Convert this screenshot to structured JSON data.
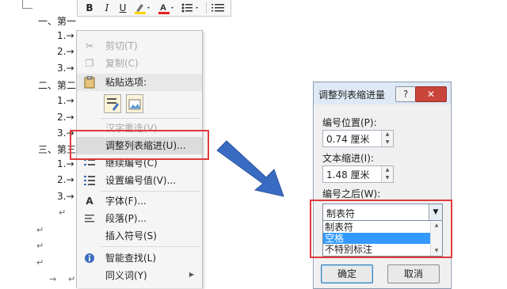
{
  "toolbar": {
    "bold": "B",
    "italic": "I",
    "underline": "U"
  },
  "document": {
    "lines": [
      "一、第一",
      "1.→",
      "2.→",
      "3.→",
      "二、第二",
      "1.→",
      "2.→",
      "3.→",
      "三、第三",
      "1.→",
      "2.→",
      "3.→"
    ],
    "tab_mark": "→",
    "para_mark": "↵"
  },
  "context_menu": {
    "cut": "剪切(T)",
    "copy": "复制(C)",
    "paste_options": "粘贴选项:",
    "reconvert": "汉字重选(V)",
    "adjust_indent": "调整列表缩进(U)...",
    "continue_numbering": "继续编号(C)",
    "set_number_value": "设置编号值(V)...",
    "font": "字体(F)...",
    "paragraph": "段落(P)...",
    "insert_symbol": "插入符号(S)",
    "smart_lookup": "智能查找(L)",
    "synonyms": "同义词(Y)"
  },
  "dialog": {
    "title": "调整列表缩进量",
    "help": "?",
    "close": "✕",
    "number_position_label": "编号位置(P):",
    "number_position_value": "0.74 厘米",
    "text_indent_label": "文本缩进(I):",
    "text_indent_value": "1.48 厘米",
    "follow_number_label": "编号之后(W):",
    "follow_number_selected": "制表符",
    "follow_number_options": [
      "制表符",
      "空格",
      "不特别标注"
    ],
    "ok": "确定",
    "cancel": "取消"
  },
  "colors": {
    "highlight_box": "#e03a3a",
    "arrow": "#3a6bc2",
    "selected_option": "#3399ff"
  }
}
